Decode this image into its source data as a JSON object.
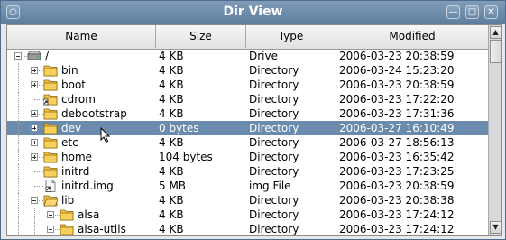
{
  "window": {
    "title": "Dir View",
    "sys_glyph": "○",
    "min_glyph": "—",
    "max_glyph": "□",
    "close_glyph": "✕"
  },
  "columns": {
    "name": "Name",
    "size": "Size",
    "type": "Type",
    "modified": "Modified"
  },
  "colors": {
    "selection": "#6b8bad",
    "folder": "#f4c146",
    "titlebar": "#6e8cab"
  },
  "rows": [
    {
      "name": "/",
      "size": "4 KB",
      "type": "Drive",
      "modified": "2006-03-23 20:38:59",
      "icon": "drive-icon",
      "depth": 0,
      "expander": "minus",
      "selected": false
    },
    {
      "name": "bin",
      "size": "4 KB",
      "type": "Directory",
      "modified": "2006-03-24 15:23:20",
      "icon": "folder-icon",
      "depth": 1,
      "expander": "plus",
      "selected": false
    },
    {
      "name": "boot",
      "size": "4 KB",
      "type": "Directory",
      "modified": "2006-03-23 20:38:59",
      "icon": "folder-icon",
      "depth": 1,
      "expander": "plus",
      "selected": false
    },
    {
      "name": "cdrom",
      "size": "4 KB",
      "type": "Directory",
      "modified": "2006-03-23 17:22:20",
      "icon": "folder-link-icon",
      "depth": 1,
      "expander": "none",
      "selected": false
    },
    {
      "name": "debootstrap",
      "size": "4 KB",
      "type": "Directory",
      "modified": "2006-03-23 17:31:36",
      "icon": "folder-icon",
      "depth": 1,
      "expander": "plus",
      "selected": false
    },
    {
      "name": "dev",
      "size": "0 bytes",
      "type": "Directory",
      "modified": "2006-03-27 16:10:49",
      "icon": "folder-icon",
      "depth": 1,
      "expander": "plus",
      "selected": true
    },
    {
      "name": "etc",
      "size": "4 KB",
      "type": "Directory",
      "modified": "2006-03-27 18:56:13",
      "icon": "folder-icon",
      "depth": 1,
      "expander": "plus",
      "selected": false
    },
    {
      "name": "home",
      "size": "104 bytes",
      "type": "Directory",
      "modified": "2006-03-23 16:35:42",
      "icon": "folder-icon",
      "depth": 1,
      "expander": "plus",
      "selected": false
    },
    {
      "name": "initrd",
      "size": "4 KB",
      "type": "Directory",
      "modified": "2006-03-23 17:23:25",
      "icon": "folder-icon",
      "depth": 1,
      "expander": "none",
      "selected": false
    },
    {
      "name": "initrd.img",
      "size": "5 MB",
      "type": "img File",
      "modified": "2006-03-23 20:38:59",
      "icon": "file-link-icon",
      "depth": 1,
      "expander": "none",
      "selected": false
    },
    {
      "name": "lib",
      "size": "4 KB",
      "type": "Directory",
      "modified": "2006-03-23 20:38:38",
      "icon": "folder-open-icon",
      "depth": 1,
      "expander": "minus",
      "selected": false
    },
    {
      "name": "alsa",
      "size": "4 KB",
      "type": "Directory",
      "modified": "2006-03-23 17:24:12",
      "icon": "folder-icon",
      "depth": 2,
      "expander": "plus",
      "selected": false
    },
    {
      "name": "alsa-utils",
      "size": "4 KB",
      "type": "Directory",
      "modified": "2006-03-23 17:24:12",
      "icon": "folder-icon",
      "depth": 2,
      "expander": "plus",
      "selected": false
    }
  ],
  "scrollbar": {
    "up_glyph": "▲",
    "down_glyph": "▼"
  }
}
